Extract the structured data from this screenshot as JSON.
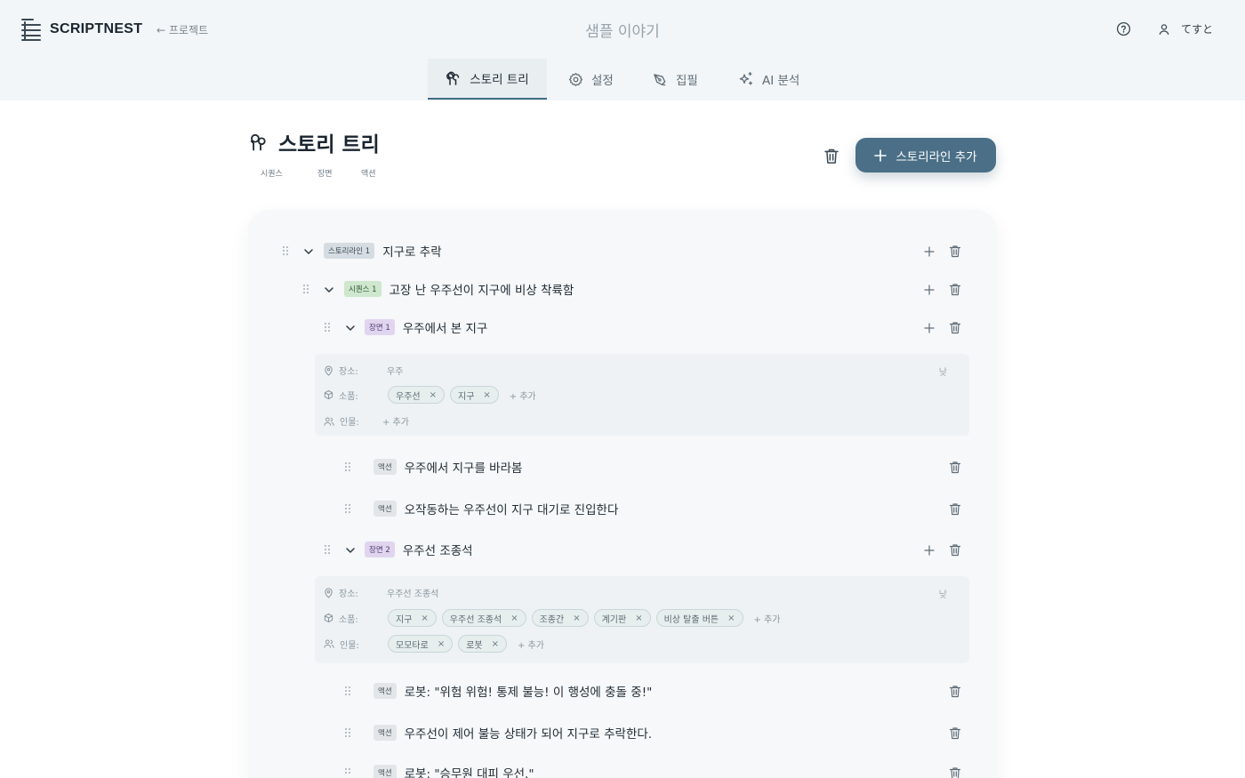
{
  "header": {
    "brand": "SCRIPTNEST",
    "back_link": "← 프로젝트",
    "document_title": "샘플 이야기",
    "user_name": "てすと"
  },
  "tabs": [
    {
      "label": "스토리 트리",
      "icon": "tree-icon",
      "active": true
    },
    {
      "label": "설정",
      "icon": "gear-icon",
      "active": false
    },
    {
      "label": "집필",
      "icon": "pen-icon",
      "active": false
    },
    {
      "label": "AI 분석",
      "icon": "sparkles-icon",
      "active": false
    }
  ],
  "page": {
    "title": "스토리 트리",
    "legend": [
      "시퀀스",
      "장면",
      "액션"
    ],
    "add_storyline_label": "스토리라인 추가"
  },
  "tree": {
    "storyline": {
      "badge": "스토리라인 1",
      "title": "지구로 추락"
    },
    "sequence": {
      "badge": "시퀀스 1",
      "title": "고장 난 우주선이 지구에 비상 착륙함"
    },
    "scene1": {
      "badge": "장면 1",
      "title": "우주에서 본 지구",
      "place_label": "장소:",
      "place": "우주",
      "time": "낮",
      "props_label": "소품:",
      "props": [
        "우주선",
        "지구"
      ],
      "people_label": "인물:",
      "people": [],
      "add_label": "+ 추가",
      "actions": [
        {
          "badge": "액션",
          "text": "우주에서 지구를 바라봄"
        },
        {
          "badge": "액션",
          "text": "오작동하는 우주선이 지구 대기로 진입한다"
        }
      ]
    },
    "scene2": {
      "badge": "장면 2",
      "title": "우주선 조종석",
      "place_label": "장소:",
      "place": "우주선 조종석",
      "time": "낮",
      "props_label": "소품:",
      "props": [
        "지구",
        "우주선 조종석",
        "조종간",
        "계기판",
        "비상 탈출 버튼"
      ],
      "people_label": "인물:",
      "people": [
        "모모타로",
        "로봇"
      ],
      "add_label": "+ 추가",
      "actions": [
        {
          "badge": "액션",
          "text": "로봇: \"위험 위험! 통제 불능! 이 행성에 충돌 중!\""
        },
        {
          "badge": "액션",
          "text": "우주선이 제어 불능 상태가 되어 지구로 추락한다."
        },
        {
          "badge": "액션",
          "text": "로봇: \"승무원 대피 우선.\""
        }
      ]
    }
  },
  "colors": {
    "primary": "#4a6f87",
    "storyline_badge": "#d6dde2",
    "sequence_badge": "#cfe6cf",
    "scene_badge": "#e0d5ef",
    "action_badge": "#e3e6e8"
  }
}
